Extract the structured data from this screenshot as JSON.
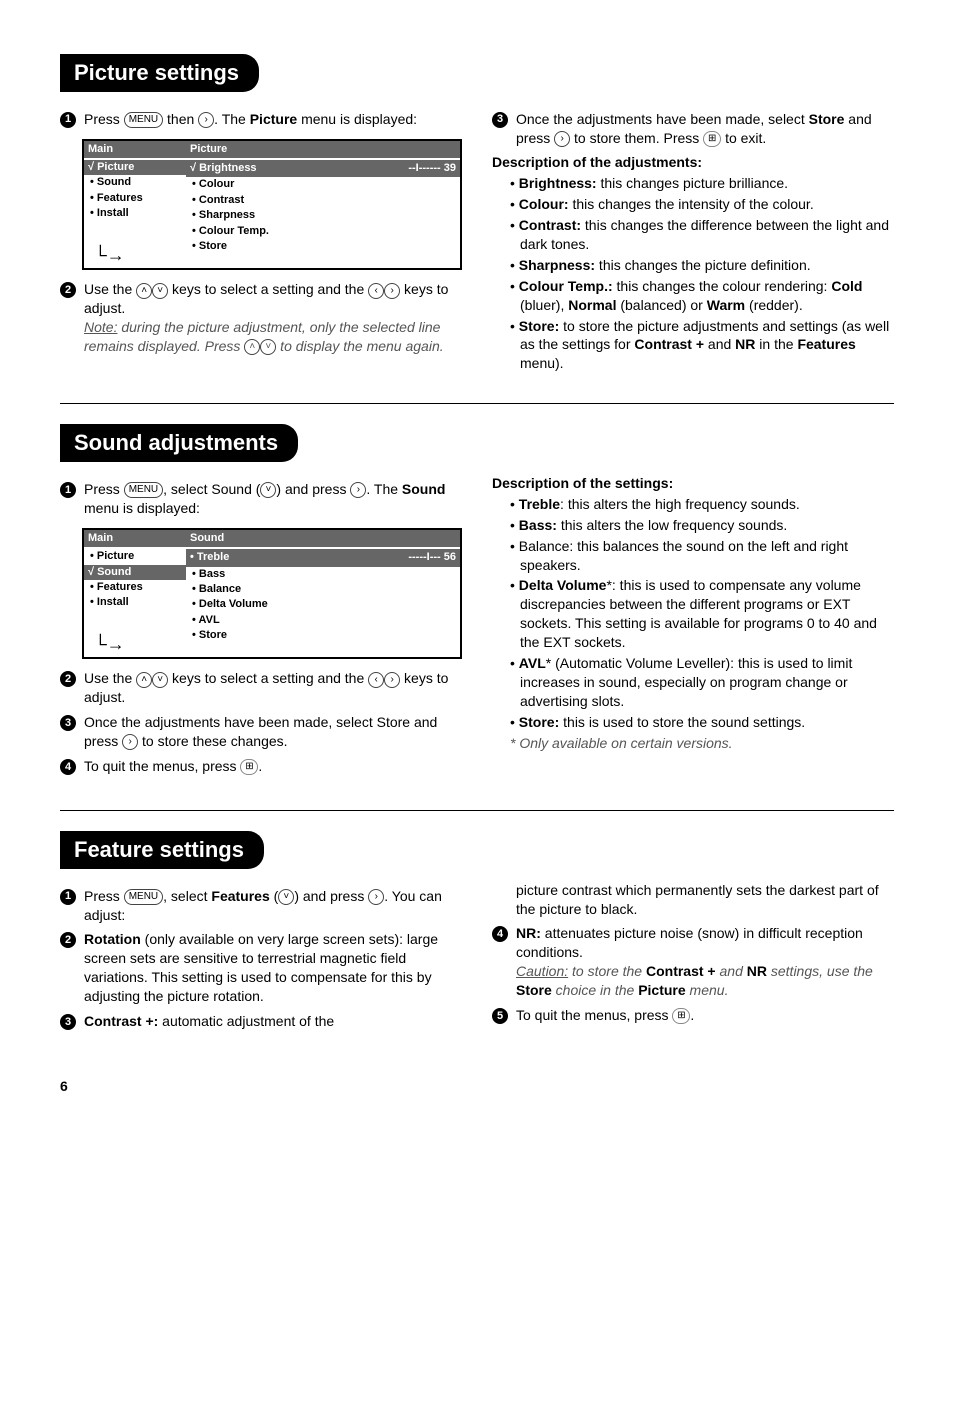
{
  "picture_section": {
    "heading": "Picture settings",
    "step1_pre": "Press ",
    "step1_mid": " then ",
    "step1_suf": ". The ",
    "step1_bold": "Picture",
    "step1_end": " menu is displayed:",
    "menu": {
      "main_title": "Main",
      "main_items": [
        "√ Picture",
        "• Sound",
        "• Features",
        "• Install"
      ],
      "detail_title": "Picture",
      "sel_label": "√ Brightness",
      "sel_value": "--I------ 39",
      "detail_items": [
        "• Colour",
        "• Contrast",
        "• Sharpness",
        "• Colour Temp.",
        "• Store"
      ]
    },
    "step2_pre": "Use the ",
    "step2_mid": " keys to select a setting and the ",
    "step2_end": " keys to adjust.",
    "note_label": "Note:",
    "note_text": " during the picture adjustment, only the selected line remains displayed. Press ",
    "note_end": " to display the menu again.",
    "step3_pre": "Once the adjustments have been made, select ",
    "step3_bold": "Store",
    "step3_mid": " and press ",
    "step3_mid2": " to store them. Press ",
    "step3_end": " to exit.",
    "desc_title": "Description of the adjustments:",
    "desc": [
      {
        "b": "Brightness:",
        "t": " this changes picture brilliance."
      },
      {
        "b": "Colour:",
        "t": " this changes the intensity of the colour."
      },
      {
        "b": "Contrast:",
        "t": " this changes the difference between the light and dark tones."
      },
      {
        "b": "Sharpness:",
        "t": " this changes the picture definition."
      },
      {
        "b": "Colour Temp.:",
        "t": " this changes the colour rendering: ",
        "b2": "Cold",
        "t2": " (bluer), ",
        "b3": "Normal",
        "t3": " (balanced) or ",
        "b4": "Warm",
        "t4": " (redder)."
      },
      {
        "b": "Store:",
        "t": " to store the picture adjustments and settings (as well as the settings for ",
        "b2": "Contrast +",
        "t2": " and ",
        "b3": "NR",
        "t3": " in the ",
        "b4": "Features",
        "t4": " menu)."
      }
    ]
  },
  "sound_section": {
    "heading": "Sound adjustments",
    "step1_pre": "Press ",
    "step1_mid": ", select Sound (",
    "step1_mid2": ") and press ",
    "step1_end": ". The ",
    "step1_bold": "Sound",
    "step1_end2": " menu is displayed:",
    "menu": {
      "main_title": "Main",
      "main_items": [
        "• Picture",
        "√ Sound",
        "• Features",
        "• Install"
      ],
      "detail_title": "Sound",
      "sel_label": "• Treble",
      "sel_value": "-----I--- 56",
      "detail_items": [
        "• Bass",
        "• Balance",
        "• Delta Volume",
        "• AVL",
        "• Store"
      ]
    },
    "step2_pre": "Use the ",
    "step2_mid": " keys to select a setting and the ",
    "step2_end": " keys to adjust.",
    "step3_pre": "Once the adjustments have been made, select Store and press ",
    "step3_end": " to store these changes.",
    "step4_pre": "To quit the menus, press ",
    "step4_end": ".",
    "desc_title": "Description of the settings:",
    "desc": [
      {
        "b": "Treble",
        "t": ": this alters the high frequency sounds."
      },
      {
        "b": "Bass:",
        "t": " this alters the low frequency sounds."
      },
      {
        "b": "",
        "t": "Balance: this balances the sound on the left and right speakers."
      },
      {
        "b": "Delta Volume",
        "t": "*: this is used to compensate any volume discrepancies between the different programs or EXT sockets. This setting is available for programs 0 to 40 and the EXT sockets."
      },
      {
        "b": "AVL",
        "t": "* (Automatic Volume Leveller): this is used to limit increases in sound, especially on program change or advertising slots."
      },
      {
        "b": "Store:",
        "t": " this is used to store the sound settings."
      }
    ],
    "footnote": "* Only available on certain versions."
  },
  "feature_section": {
    "heading": "Feature settings",
    "step1_pre": "Press ",
    "step1_mid": ", select ",
    "step1_bold": "Features",
    "step1_mid2": " (",
    "step1_mid3": ") and press ",
    "step1_end": ". You can adjust:",
    "step2_bold": "Rotation",
    "step2_text": " (only available on very large screen sets): large screen sets are sensitive to terrestrial magnetic field variations. This setting is used to compensate for this by adjusting the picture rotation.",
    "step3_bold": "Contrast +:",
    "step3_text": " automatic adjustment of the",
    "step3_cont": "picture contrast which permanently sets the darkest part of the picture to black.",
    "step4_bold": "NR:",
    "step4_text": " attenuates picture noise (snow) in difficult reception conditions.",
    "caution_label": "Caution:",
    "caution_text": " to store the ",
    "caution_b1": "Contrast +",
    "caution_mid": " and ",
    "caution_b2": "NR",
    "caution_mid2": " settings, use the ",
    "caution_b3": "Store",
    "caution_mid3": " choice in the ",
    "caution_b4": "Picture",
    "caution_end": " menu.",
    "step5_pre": "To quit the menus, press ",
    "step5_end": "."
  },
  "keys": {
    "menu": "MENU",
    "right": "›",
    "left": "‹",
    "up": "˄",
    "down": "˅",
    "exit": "⊞"
  },
  "page_number": "6"
}
